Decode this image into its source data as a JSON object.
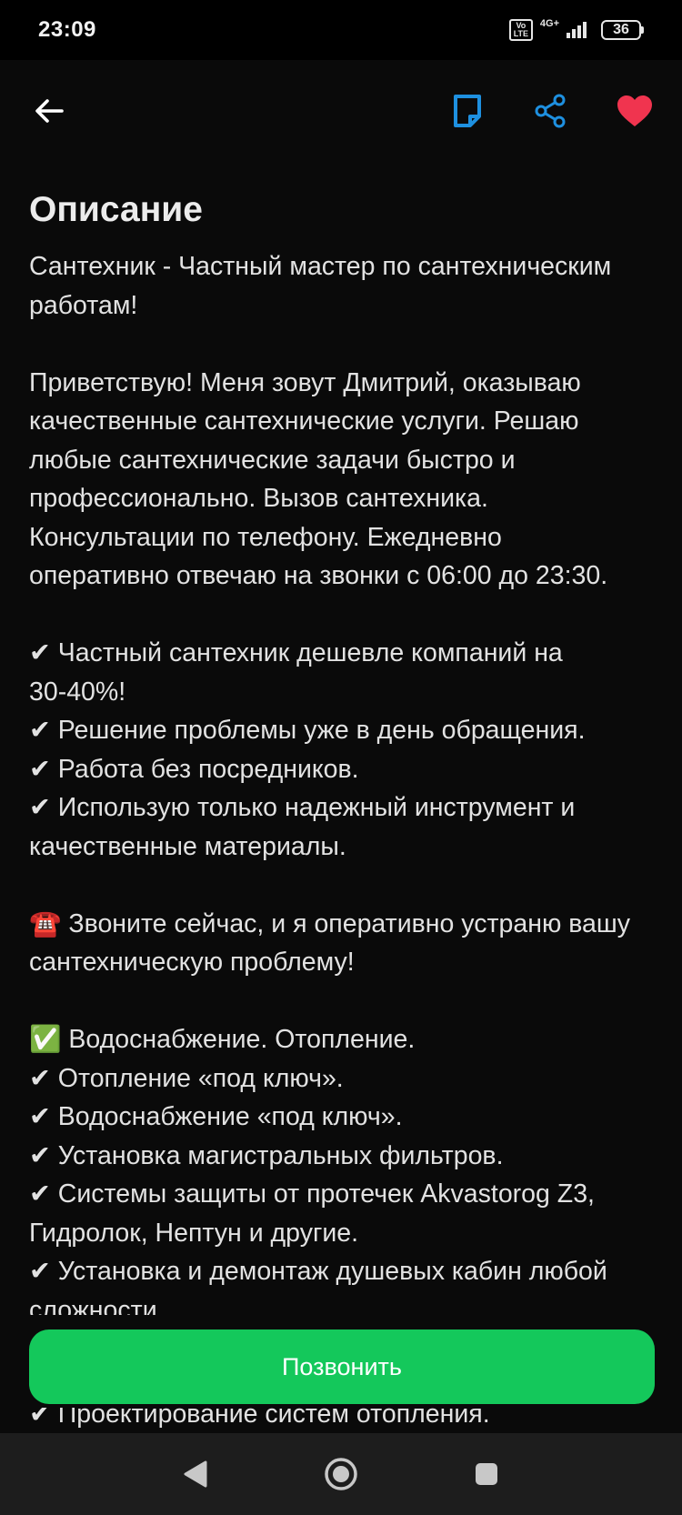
{
  "status_bar": {
    "time": "23:09",
    "volte": "Vo LTE",
    "network": "4G+",
    "battery": "36"
  },
  "app_bar": {
    "back_icon": "arrow-left-icon",
    "note_icon": "note-icon",
    "share_icon": "share-icon",
    "favorite_icon": "heart-icon"
  },
  "colors": {
    "background": "#0a0a0a",
    "accent_blue": "#1e90e0",
    "favorite_red": "#f0344f",
    "call_green": "#14c85b",
    "nav_bar": "#1d1d1d"
  },
  "description": {
    "title": "Описание",
    "lines": [
      "Сантехник - Частный мастер по сантехническим",
      "работам!",
      "",
      "Приветствую! Меня зовут Дмитрий, оказываю",
      "качественные сантехнические услуги. Решаю",
      "любые сантехнические задачи быстро и",
      "профессионально. Вызов сантехника.",
      "Консультации по телефону. Ежедневно",
      "оперативно отвечаю на звонки с 06:00 до 23:30.",
      "",
      "✔ Частный сантехник дешевле компаний на",
      "30-40%!",
      "✔ Решение проблемы уже в день обращения.",
      "✔ Работа без посредников.",
      "✔ Использую только надежный инструмент и",
      "качественные материалы.",
      "",
      "☎️ Звоните сейчас, и я оперативно устраню вашу",
      "сантехническую проблему!",
      "",
      "✅ Водоснабжение. Отопление.",
      "✔ Отопление «под ключ».",
      "✔ Водоснабжение «под ключ».",
      "✔ Установка магистральных фильтров.",
      "✔ Системы защиты от протечек Akvastorog Z3,",
      "Гидролок, Нептун и другие.",
      "✔ Установка и демонтаж душевых кабин любой",
      "сложности."
    ],
    "peek_line": "✔ Проектирование систем отопления."
  },
  "call_button": {
    "label": "Позвонить"
  },
  "nav_bar": {
    "back": "triangle-back-icon",
    "home": "circle-home-icon",
    "recents": "square-recents-icon"
  }
}
